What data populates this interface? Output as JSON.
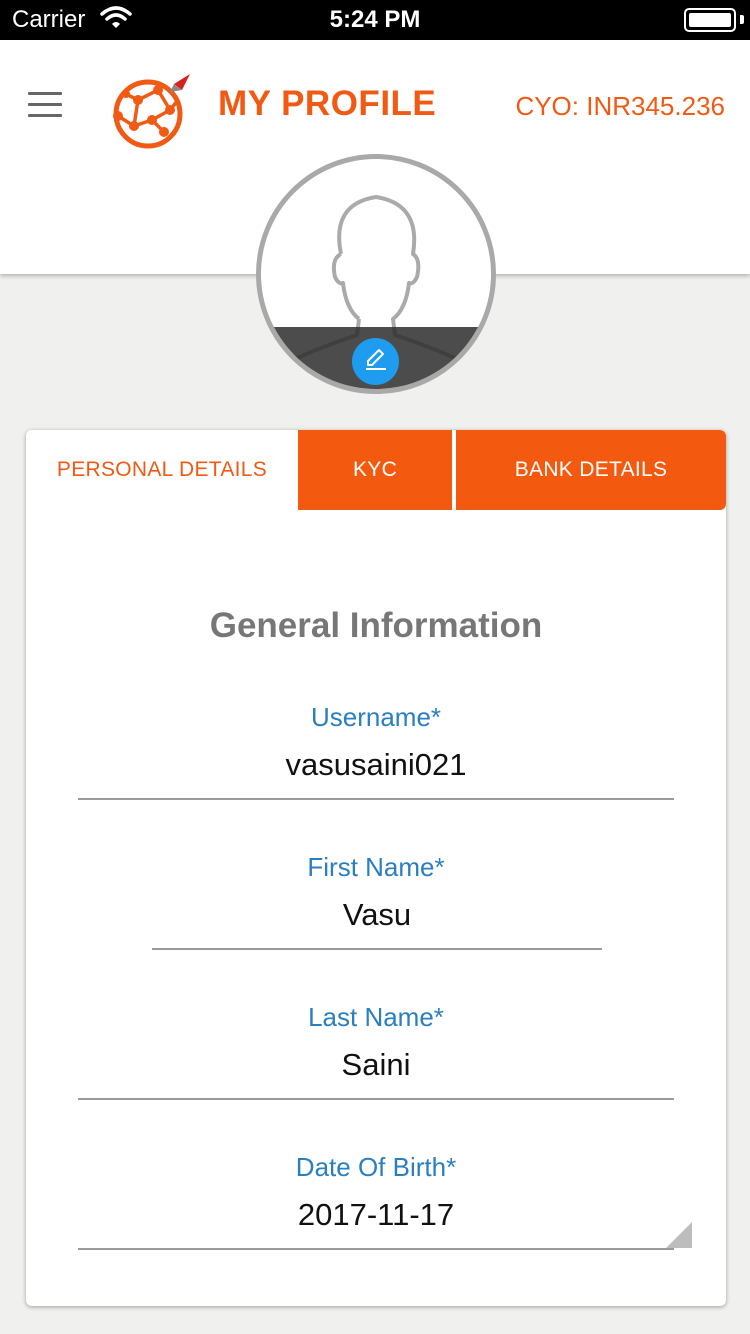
{
  "status_bar": {
    "carrier": "Carrier",
    "time": "5:24 PM"
  },
  "header": {
    "title": "MY PROFILE",
    "balance": "CYO: INR345.236"
  },
  "colors": {
    "accent": "#f05a14",
    "tab_active_bg": "#f45a0f",
    "label": "#2a7fbf",
    "edit_button": "#1e9cf0"
  },
  "icons": [
    "menu-icon",
    "logo-icon",
    "wifi-icon",
    "battery-icon",
    "avatar-placeholder-icon",
    "pencil-icon"
  ],
  "tabs": [
    {
      "label": "PERSONAL DETAILS",
      "active": true
    },
    {
      "label": "KYC",
      "active": false
    },
    {
      "label": "BANK DETAILS",
      "active": false
    }
  ],
  "section_title": "General Information",
  "fields": {
    "username": {
      "label": "Username*",
      "value": "vasusaini021"
    },
    "first_name": {
      "label": "First Name*",
      "value": "Vasu"
    },
    "last_name": {
      "label": "Last Name*",
      "value": "Saini"
    },
    "dob": {
      "label": "Date Of Birth*",
      "value": "2017-11-17"
    }
  }
}
